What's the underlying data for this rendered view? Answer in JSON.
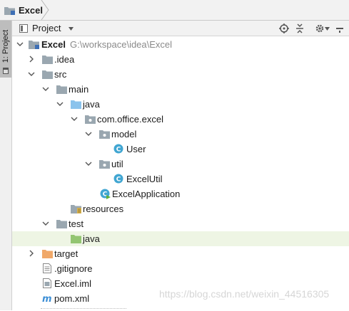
{
  "breadcrumb": {
    "label": "Excel"
  },
  "side_tab": {
    "label": "1: Project"
  },
  "toolbar": {
    "title": "Project"
  },
  "tree": {
    "root": {
      "name": "Excel",
      "path": "G:\\workspace\\idea\\Excel"
    },
    "idea": ".idea",
    "src": "src",
    "main": "main",
    "java": "java",
    "package": "com.office.excel",
    "model": "model",
    "user": "User",
    "util": "util",
    "excelutil": "ExcelUtil",
    "app": "ExcelApplication",
    "resources": "resources",
    "test": "test",
    "test_java": "java",
    "target": "target",
    "gitignore": ".gitignore",
    "iml": "Excel.iml",
    "pom": "pom.xml"
  },
  "watermark": "https://blog.csdn.net/weixin_44516305",
  "colors": {
    "folder": "#9aa7b0",
    "source_folder": "#8bc3ec",
    "test_folder": "#93c572",
    "excluded_folder": "#f0a869",
    "class_icon": "#41a6d2",
    "highlight_row": "#eef5e4"
  }
}
